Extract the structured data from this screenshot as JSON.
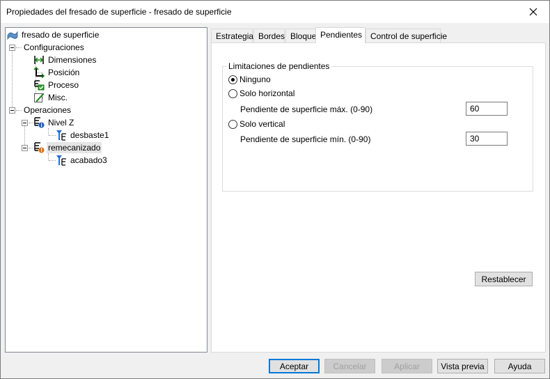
{
  "window": {
    "title": "Propiedades del fresado de superficie - fresado de superficie"
  },
  "tree": {
    "root": "fresado de superficie",
    "configuraciones": {
      "label": "Configuraciones",
      "items": [
        "Dimensiones",
        "Posición",
        "Proceso",
        "Misc."
      ]
    },
    "operaciones": {
      "label": "Operaciones",
      "nivel_z": {
        "label": "Nivel Z",
        "child": "desbaste1"
      },
      "remecanizado": {
        "label": "remecanizado",
        "child": "acabado3"
      }
    }
  },
  "tabs": [
    "Estrategia",
    "Bordes",
    "Bloque",
    "Pendientes",
    "Control de superficie"
  ],
  "active_tab": "Pendientes",
  "pendientes": {
    "group_title": "Limitaciones de pendientes",
    "options": {
      "ninguno": "Ninguno",
      "horizontal": "Solo horizontal",
      "vertical": "Solo vertical"
    },
    "selected": "Ninguno",
    "max_label": "Pendiente de superficie máx. (0-90)",
    "max_value": "60",
    "min_label": "Pendiente de superficie mín. (0-90)",
    "min_value": "30",
    "reset": "Restablecer"
  },
  "buttons": {
    "accept": "Aceptar",
    "cancel": "Cancelar",
    "apply": "Aplicar",
    "preview": "Vista previa",
    "help": "Ayuda"
  },
  "colors": {
    "accent": "#0078d7",
    "tree_border": "#828790",
    "disabled_text": "#a0a0a0"
  }
}
